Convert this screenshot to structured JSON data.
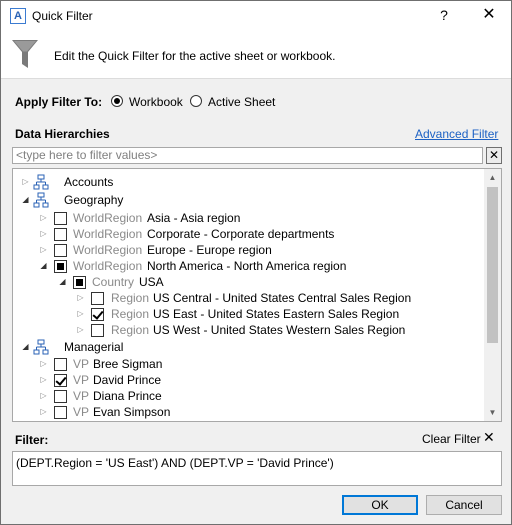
{
  "window": {
    "title": "Quick Filter",
    "app_icon_letter": "A",
    "help_label": "?",
    "close_label": "✕"
  },
  "description": "Edit the Quick Filter for the active sheet or workbook.",
  "apply_filter": {
    "label": "Apply Filter To:",
    "options": [
      {
        "label": "Workbook",
        "selected": true
      },
      {
        "label": "Active Sheet",
        "selected": false
      }
    ]
  },
  "hierarchies": {
    "label": "Data Hierarchies",
    "advanced_link": "Advanced Filter",
    "search_placeholder": "<type here to filter values>",
    "clear_button": "✕"
  },
  "tree": [
    {
      "level_name": "",
      "text": "Accounts"
    },
    {
      "level_name": "",
      "text": "Geography"
    },
    {
      "level_name": "WorldRegion",
      "text": "Asia - Asia region",
      "state": "unchecked"
    },
    {
      "level_name": "WorldRegion",
      "text": "Corporate - Corporate departments",
      "state": "unchecked"
    },
    {
      "level_name": "WorldRegion",
      "text": "Europe - Europe region",
      "state": "unchecked"
    },
    {
      "level_name": "WorldRegion",
      "text": "North America - North America region",
      "state": "partial"
    },
    {
      "level_name": "Country",
      "text": "USA",
      "state": "partial"
    },
    {
      "level_name": "Region",
      "text": "US Central - United States Central Sales Region",
      "state": "unchecked"
    },
    {
      "level_name": "Region",
      "text": "US East - United States Eastern Sales Region",
      "state": "checked"
    },
    {
      "level_name": "Region",
      "text": "US West - United States Western Sales Region",
      "state": "unchecked"
    },
    {
      "level_name": "",
      "text": "Managerial"
    },
    {
      "level_name": "VP",
      "text": "Bree Sigman",
      "state": "unchecked"
    },
    {
      "level_name": "VP",
      "text": "David Prince",
      "state": "checked"
    },
    {
      "level_name": "VP",
      "text": "Diana Prince",
      "state": "unchecked"
    },
    {
      "level_name": "VP",
      "text": "Evan Simpson",
      "state": "unchecked"
    }
  ],
  "filter": {
    "label": "Filter:",
    "clear_label": "Clear Filter",
    "clear_icon": "✕",
    "expression": "(DEPT.Region = 'US East')  AND  (DEPT.VP = 'David Prince')"
  },
  "buttons": {
    "ok": "OK",
    "cancel": "Cancel"
  },
  "colors": {
    "link": "#1c61c4",
    "accent": "#0078d7",
    "level_name": "#8a8a8a"
  }
}
